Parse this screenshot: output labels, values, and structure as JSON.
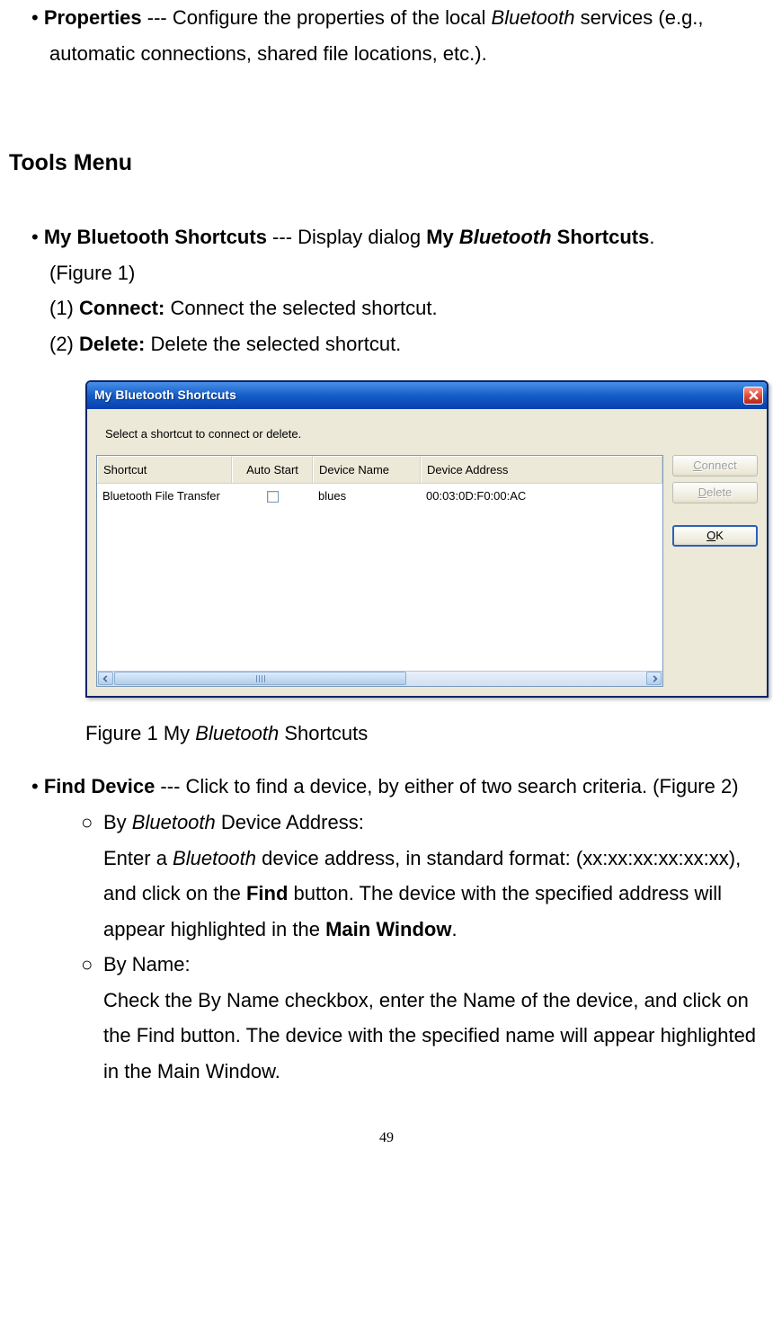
{
  "topItem": {
    "title": "Properties",
    "sep": " --- ",
    "desc1": "Configure the properties of the local ",
    "bt": "Bluetooth",
    "desc2": " services (e.g., automatic connections, shared file locations, etc.)."
  },
  "heading": "Tools Menu",
  "item1": {
    "title": "My Bluetooth Shortcuts",
    "sep": " --- ",
    "desc1": "Display dialog ",
    "bold1": "My ",
    "bi": "Bluetooth",
    "bold2": " Shortcuts",
    "period": ".",
    "figref": "(Figure 1)",
    "l1a": "(1) ",
    "l1b": "Connect:",
    "l1c": " Connect the selected shortcut.",
    "l2a": "(2) ",
    "l2b": "Delete:",
    "l2c": " Delete the selected shortcut."
  },
  "dlg": {
    "title": "My Bluetooth Shortcuts",
    "prompt": "Select a shortcut to connect or delete.",
    "cols": {
      "c1": "Shortcut",
      "c2": "Auto Start",
      "c3": "Device Name",
      "c4": "Device Address"
    },
    "row": {
      "shortcut": "Bluetooth File Transfer",
      "device_name": "blues",
      "device_addr": "00:03:0D:F0:00:AC"
    },
    "buttons": {
      "connect": "onnect",
      "connectU": "C",
      "delete": "elete",
      "deleteU": "D",
      "ok": "K",
      "okU": "O"
    }
  },
  "caption": {
    "pre": "Figure 1 My ",
    "bt": "Bluetooth",
    "post": " Shortcuts"
  },
  "item2": {
    "title": "Find Device",
    "sep": " --- ",
    "desc": "Click to find a device, by either of two search criteria. (Figure 2)",
    "sub1": {
      "title_pre": "By ",
      "bt": "Bluetooth",
      "title_post": " Device Address:",
      "l1_pre": "Enter a ",
      "l1_bt": "Bluetooth",
      "l1_post": " device address, in standard format: (xx:xx:xx:xx:xx:xx), and click on the ",
      "find": "Find",
      "l2": " button. The device with the specified address will appear highlighted in the ",
      "main": "Main Window",
      "end": "."
    },
    "sub2": {
      "title": "By Name:",
      "body": "Check the By Name checkbox, enter the Name of the device, and click on the Find button. The device with the specified name will appear highlighted in the Main Window."
    }
  },
  "pageNum": "49"
}
